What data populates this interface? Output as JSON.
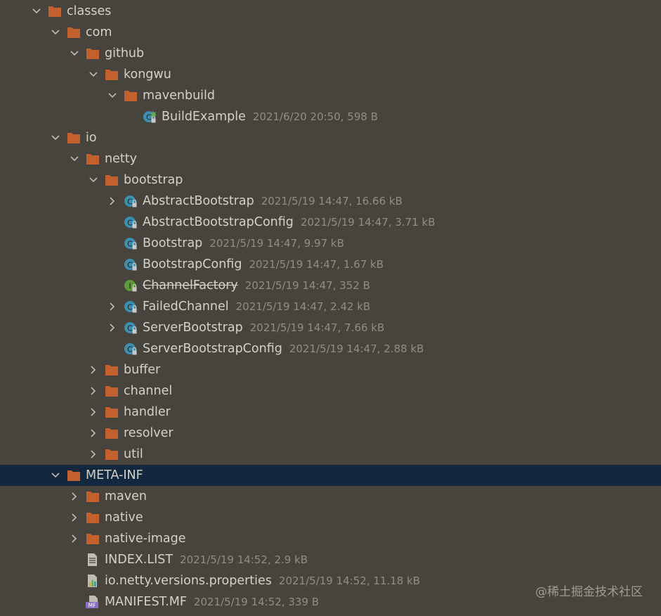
{
  "tree": [
    {
      "label": "classes",
      "type": "folder",
      "level": 0,
      "expanded": true
    },
    {
      "label": "com",
      "type": "folder",
      "level": 1,
      "expanded": true
    },
    {
      "label": "github",
      "type": "folder",
      "level": 2,
      "expanded": true
    },
    {
      "label": "kongwu",
      "type": "folder",
      "level": 3,
      "expanded": true
    },
    {
      "label": "mavenbuild",
      "type": "folder",
      "level": 4,
      "expanded": true
    },
    {
      "label": "BuildExample",
      "type": "class",
      "icon": "class-main-icon",
      "level": 5,
      "meta": "2021/6/20 20:50, 598 B"
    },
    {
      "label": "io",
      "type": "folder",
      "level": 1,
      "expanded": true
    },
    {
      "label": "netty",
      "type": "folder",
      "level": 2,
      "expanded": true
    },
    {
      "label": "bootstrap",
      "type": "folder",
      "level": 3,
      "expanded": true
    },
    {
      "label": "AbstractBootstrap",
      "type": "class",
      "icon": "abstract-class-icon",
      "level": 4,
      "expandable": true,
      "meta": "2021/5/19 14:47, 16.66 kB"
    },
    {
      "label": "AbstractBootstrapConfig",
      "type": "class",
      "icon": "abstract-class-icon",
      "level": 4,
      "meta": "2021/5/19 14:47, 3.71 kB"
    },
    {
      "label": "Bootstrap",
      "type": "class",
      "icon": "class-icon",
      "level": 4,
      "meta": "2021/5/19 14:47, 9.97 kB"
    },
    {
      "label": "BootstrapConfig",
      "type": "class",
      "icon": "class-icon",
      "level": 4,
      "meta": "2021/5/19 14:47, 1.67 kB"
    },
    {
      "label": "ChannelFactory",
      "type": "interface",
      "icon": "interface-icon",
      "level": 4,
      "strike": true,
      "meta": "2021/5/19 14:47, 352 B"
    },
    {
      "label": "FailedChannel",
      "type": "class",
      "icon": "class-icon",
      "level": 4,
      "expandable": true,
      "meta": "2021/5/19 14:47, 2.42 kB"
    },
    {
      "label": "ServerBootstrap",
      "type": "class",
      "icon": "class-icon",
      "level": 4,
      "expandable": true,
      "meta": "2021/5/19 14:47, 7.66 kB"
    },
    {
      "label": "ServerBootstrapConfig",
      "type": "class",
      "icon": "class-icon",
      "level": 4,
      "meta": "2021/5/19 14:47, 2.88 kB"
    },
    {
      "label": "buffer",
      "type": "folder",
      "level": 3,
      "expanded": false
    },
    {
      "label": "channel",
      "type": "folder",
      "level": 3,
      "expanded": false
    },
    {
      "label": "handler",
      "type": "folder",
      "level": 3,
      "expanded": false
    },
    {
      "label": "resolver",
      "type": "folder",
      "level": 3,
      "expanded": false
    },
    {
      "label": "util",
      "type": "folder",
      "level": 3,
      "expanded": false
    },
    {
      "label": "META-INF",
      "type": "folder",
      "level": 1,
      "expanded": true,
      "selected": true
    },
    {
      "label": "maven",
      "type": "folder",
      "level": 2,
      "expanded": false
    },
    {
      "label": "native",
      "type": "folder",
      "level": 2,
      "expanded": false
    },
    {
      "label": "native-image",
      "type": "folder",
      "level": 2,
      "expanded": false
    },
    {
      "label": "INDEX.LIST",
      "type": "file",
      "icon": "text-file-icon",
      "level": 2,
      "meta": "2021/5/19 14:52, 2.9 kB"
    },
    {
      "label": "io.netty.versions.properties",
      "type": "file",
      "icon": "properties-file-icon",
      "level": 2,
      "meta": "2021/5/19 14:52, 11.18 kB"
    },
    {
      "label": "MANIFEST.MF",
      "type": "file",
      "icon": "manifest-file-icon",
      "level": 2,
      "meta": "2021/5/19 14:52, 339 B"
    }
  ],
  "watermark": "@稀土掘金技术社区",
  "colors": {
    "background": "#46443d",
    "selection": "#13283f",
    "folder": "#c3602d",
    "class_icon": "#3d8fb0",
    "interface_icon": "#5c9a3a",
    "meta_text": "#8f8d84"
  }
}
